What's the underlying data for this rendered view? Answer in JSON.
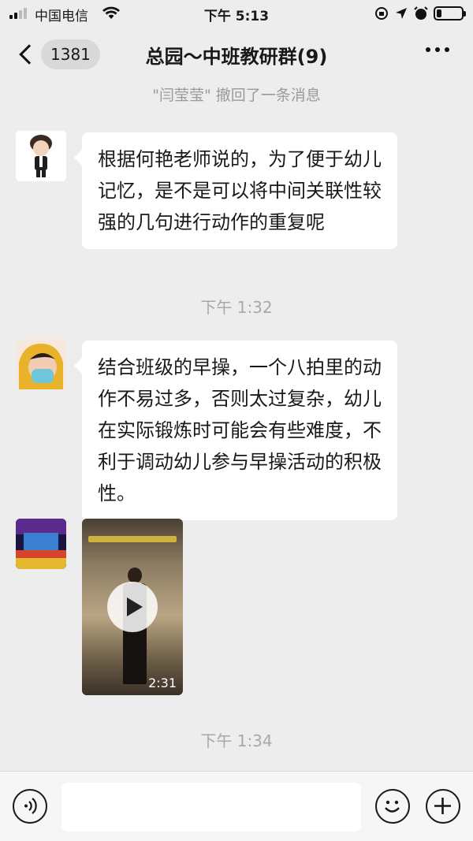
{
  "status_bar": {
    "carrier": "中国电信",
    "time": "下午 5:13",
    "battery_level": 0.2
  },
  "nav": {
    "unread_count": "1381",
    "title": "总园～中班教研群(9)",
    "back_icon": "chevron-left-icon",
    "more_icon": "more-dots-icon"
  },
  "chat": {
    "system_note": "\"闫莹莹\" 撤回了一条消息",
    "messages": [
      {
        "type": "text",
        "text": "根据何艳老师说的，为了便于幼儿记忆，是不是可以将中间关联性较强的几句进行动作的重复呢"
      },
      {
        "type": "timestamp",
        "text": "下午 1:32"
      },
      {
        "type": "text",
        "text": "结合班级的早操，一个八拍里的动作不易过多，否则太过复杂，幼儿在实际锻炼时可能会有些难度，不利于调动幼儿参与早操活动的积极性。"
      },
      {
        "type": "video",
        "duration": "2:31"
      },
      {
        "type": "timestamp",
        "text": "下午 1:34"
      }
    ]
  },
  "input_bar": {
    "voice_icon": "voice-icon",
    "emoji_icon": "emoji-icon",
    "add_icon": "plus-icon",
    "input_value": ""
  }
}
